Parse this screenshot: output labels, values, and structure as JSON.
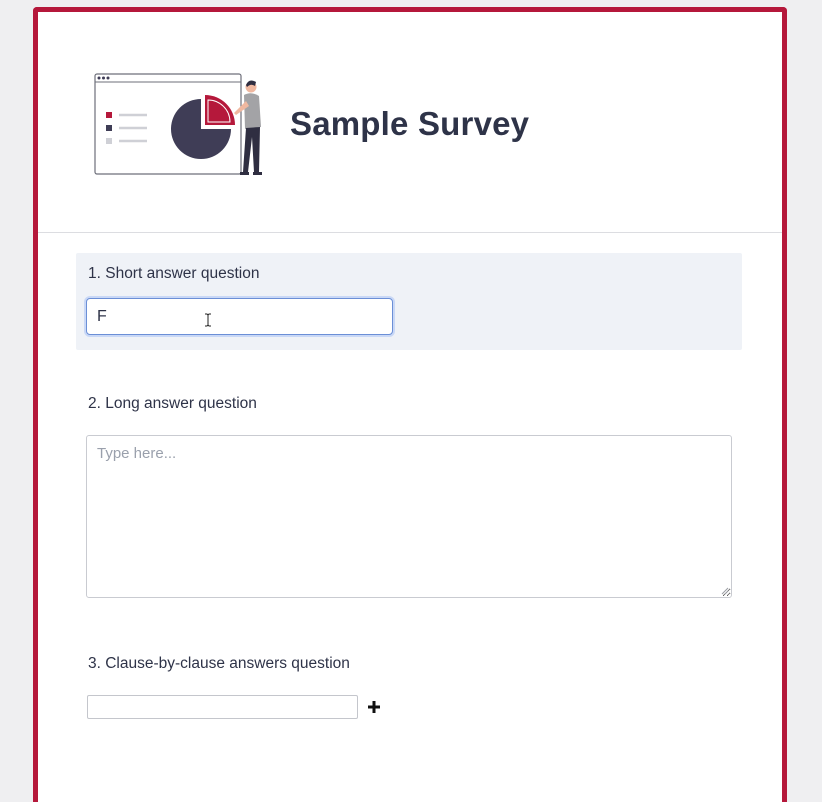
{
  "survey": {
    "title": "Sample Survey"
  },
  "questions": [
    {
      "label": "1. Short answer question",
      "value": "F",
      "placeholder": ""
    },
    {
      "label": "2. Long answer question",
      "value": "",
      "placeholder": "Type here..."
    },
    {
      "label": "3. Clause-by-clause answers question",
      "value": "",
      "placeholder": ""
    }
  ],
  "icons": {
    "illustration": "survey-chart-illustration",
    "cursor": "text-cursor-icon",
    "add": "plus-icon",
    "grip": "resize-grip-icon"
  },
  "colors": {
    "accent": "#b5183b",
    "title": "#2e3348",
    "chart_dark": "#3f3d56",
    "focus_border": "#6b8fd6",
    "question_highlight": "#eff2f7"
  }
}
